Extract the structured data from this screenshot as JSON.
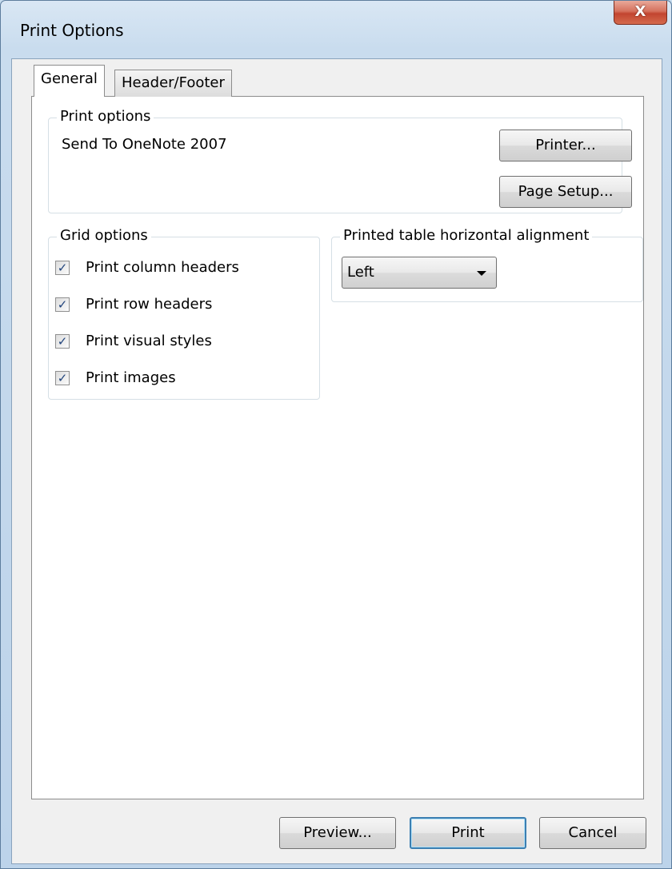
{
  "window": {
    "title": "Print Options",
    "close_label": "X"
  },
  "tabs": [
    {
      "label": "General",
      "selected": true
    },
    {
      "label": "Header/Footer",
      "selected": false
    }
  ],
  "print_options": {
    "title": "Print options",
    "printer_name": "Send To OneNote 2007",
    "printer_button": "Printer...",
    "page_setup_button": "Page Setup..."
  },
  "grid_options": {
    "title": "Grid options",
    "checkboxes": [
      {
        "label": "Print column headers",
        "checked": true
      },
      {
        "label": "Print row headers",
        "checked": true
      },
      {
        "label": "Print visual styles",
        "checked": true
      },
      {
        "label": "Print images",
        "checked": true
      }
    ],
    "check_mark": "✓"
  },
  "alignment": {
    "title": "Printed table horizontal alignment",
    "selected_value": "Left"
  },
  "footer": {
    "preview_button": "Preview...",
    "print_button": "Print",
    "cancel_button": "Cancel"
  },
  "colors": {
    "close_button": "#c24530",
    "default_button_border": "#3c7fb1",
    "checkmark": "#21447c"
  }
}
